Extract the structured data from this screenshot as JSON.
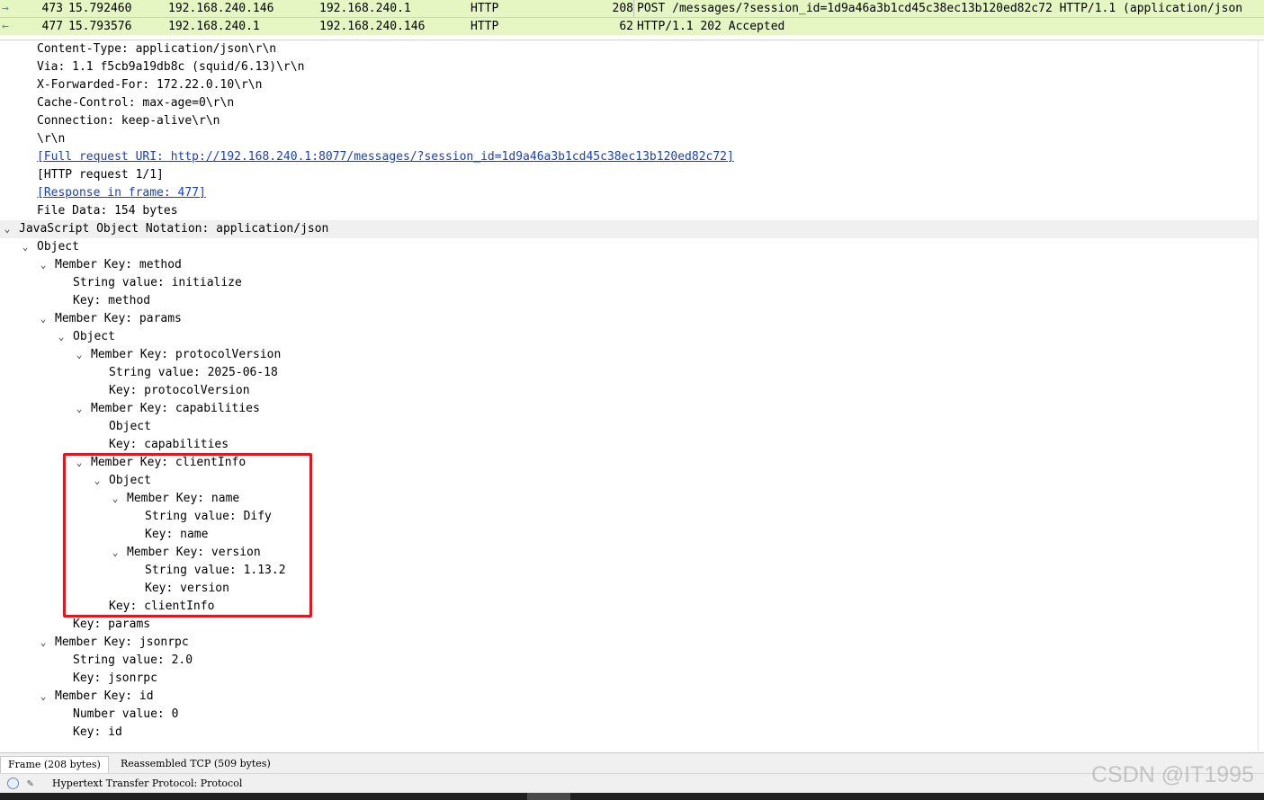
{
  "packets": [
    {
      "arrow": "→",
      "no": "473",
      "time": "15.792460",
      "src": "192.168.240.146",
      "dst": "192.168.240.1",
      "proto": "HTTP",
      "len": "208",
      "info": "POST /messages/?session_id=1d9a46a3b1cd45c38ec13b120ed82c72 HTTP/1.1  (application/json"
    },
    {
      "arrow": "←",
      "no": "477",
      "time": "15.793576",
      "src": "192.168.240.1",
      "dst": "192.168.240.146",
      "proto": "HTTP",
      "len": "62",
      "info": "HTTP/1.1 202 Accepted"
    }
  ],
  "tree": {
    "content_type": "Content-Type: application/json\\r\\n",
    "via": "Via: 1.1 f5cb9a19db8c (squid/6.13)\\r\\n",
    "x_forwarded_for": "X-Forwarded-For: 172.22.0.10\\r\\n",
    "cache_control": "Cache-Control: max-age=0\\r\\n",
    "connection": "Connection: keep-alive\\r\\n",
    "crlf": "\\r\\n",
    "full_uri": "[Full request URI: http://192.168.240.1:8077/messages/?session_id=1d9a46a3b1cd45c38ec13b120ed82c72]",
    "http_request": "[HTTP request 1/1]",
    "response_in_frame": "[Response in frame: 477]",
    "file_data": "File Data: 154 bytes",
    "json_root": "JavaScript Object Notation: application/json",
    "object": "Object",
    "mk_method": "Member Key: method",
    "sv_initialize": "String value: initialize",
    "key_method": "Key: method",
    "mk_params": "Member Key: params",
    "params_object": "Object",
    "mk_protocol": "Member Key: protocolVersion",
    "sv_protocol": "String value: 2025-06-18",
    "key_protocol": "Key: protocolVersion",
    "mk_capabilities": "Member Key: capabilities",
    "cap_object": "Object",
    "key_capabilities": "Key: capabilities",
    "mk_clientinfo": "Member Key: clientInfo",
    "ci_object": "Object",
    "mk_name": "Member Key: name",
    "sv_dify": "String value: Dify",
    "key_name": "Key: name",
    "mk_version": "Member Key: version",
    "sv_version": "String value: 1.13.2",
    "key_version": "Key: version",
    "key_clientinfo": "Key: clientInfo",
    "key_params": "Key: params",
    "mk_jsonrpc": "Member Key: jsonrpc",
    "sv_jsonrpc": "String value: 2.0",
    "key_jsonrpc": "Key: jsonrpc",
    "mk_id": "Member Key: id",
    "nv_id": "Number value: 0",
    "key_id": "Key: id"
  },
  "bytes_tabs": [
    "Frame (208 bytes)",
    "Reassembled TCP (509 bytes)"
  ],
  "status": {
    "text": "Hypertext Transfer Protocol: Protocol"
  },
  "watermark": "CSDN @IT1995",
  "icons": {
    "expanded": "chevron-down-icon",
    "status": "ready-indicator-icon",
    "edit": "edit-comment-icon"
  },
  "colors": {
    "packet_row": "#e6f6c3",
    "link": "#1a3fbf",
    "highlight": "#e8141c"
  }
}
